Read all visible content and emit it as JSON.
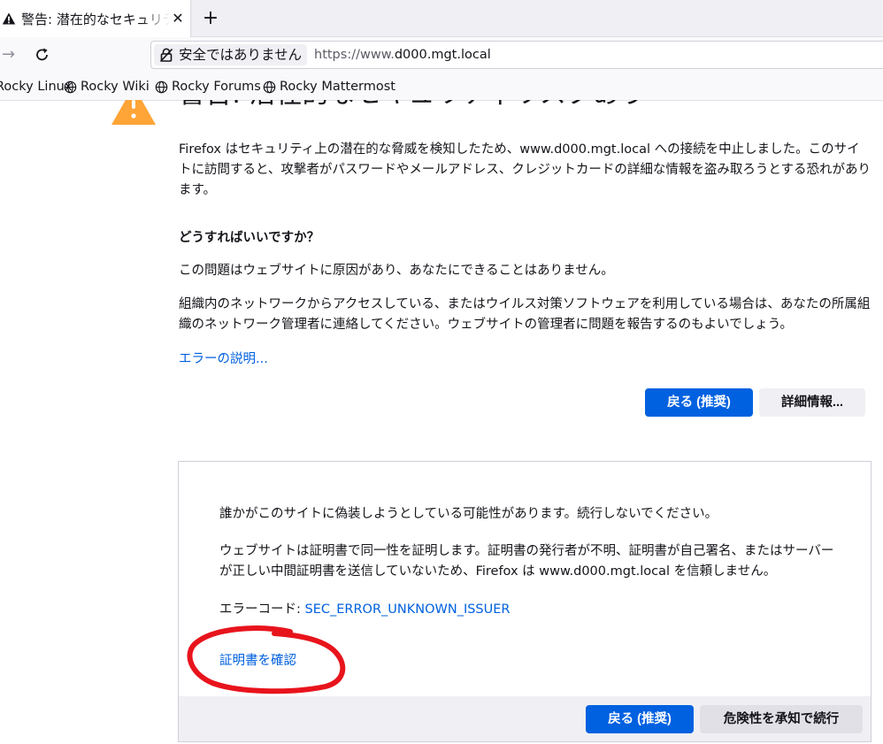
{
  "tab": {
    "title": "警告: 潜在的なセキュリティリスクあり",
    "close_label": "✕",
    "new_tab_label": "+"
  },
  "navbar": {
    "forward_glyph": "→",
    "identity_label": "安全ではありません",
    "url_prefix": "https://www.",
    "url_host": "d000.mgt.local"
  },
  "bookmarks": [
    {
      "label": "Rocky Linux"
    },
    {
      "label": "Rocky Wiki"
    },
    {
      "label": "Rocky Forums"
    },
    {
      "label": "Rocky Mattermost"
    }
  ],
  "page": {
    "title": "警告: 潜在的なセキュリティリスクあり",
    "intro": "Firefox はセキュリティ上の潜在的な脅威を検知したため、www.d000.mgt.local への接続を中止しました。このサイトに訪問すると、攻撃者がパスワードやメールアドレス、クレジットカードの詳細な情報を盗み取ろうとする恐れがあります。",
    "what_heading": "どうすればいいですか？",
    "what_p1": "この問題はウェブサイトに原因があり、あなたにできることはありません。",
    "what_p2": "組織内のネットワークからアクセスしている、またはウイルス対策ソフトウェアを利用している場合は、あなたの所属組織のネットワーク管理者に連絡してください。ウェブサイトの管理者に問題を報告するのもよいでしょう。",
    "learn_more": "エラーの説明...",
    "back_button": "戻る (推奨)",
    "advanced_button": "詳細情報..."
  },
  "advanced": {
    "line1": "誰かがこのサイトに偽装しようとしている可能性があります。続行しないでください。",
    "line2": "ウェブサイトは証明書で同一性を証明します。証明書の発行者が不明、証明書が自己署名、またはサーバーが正しい中間証明書を送信していないため、Firefox は www.d000.mgt.local を信頼しません。",
    "error_code_label": "エラーコード: ",
    "error_code": "SEC_ERROR_UNKNOWN_ISSUER",
    "view_cert": "証明書を確認",
    "back_button": "戻る (推奨)",
    "accept_button": "危険性を承知で続行"
  },
  "colors": {
    "primary_button": "#0061e0",
    "link": "#0060df",
    "warning": "#ffa436",
    "annotation": "#e8141c"
  },
  "icons": {
    "tab_warning": "warning-triangle-icon",
    "lock": "insecure-lock-icon",
    "bookmark": "globe-icon",
    "page_warning": "warning-triangle-icon"
  }
}
